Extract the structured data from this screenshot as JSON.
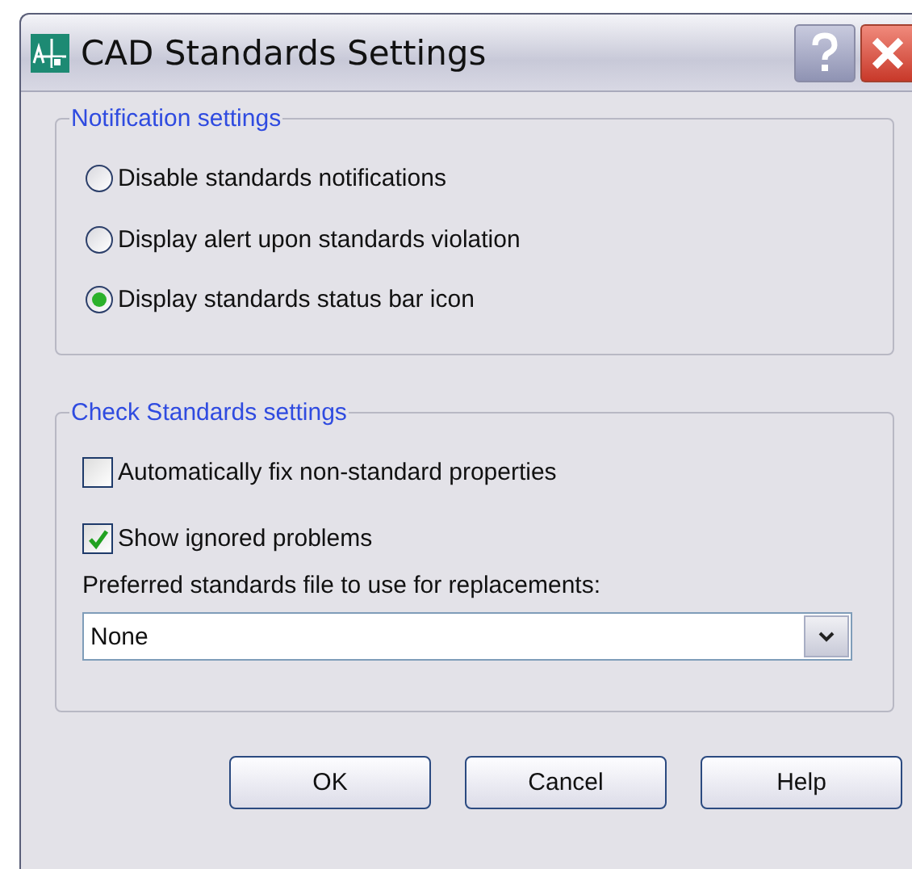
{
  "window": {
    "title": "CAD Standards Settings"
  },
  "notification_settings": {
    "title": "Notification settings",
    "options": [
      {
        "label": "Disable standards notifications",
        "selected": false
      },
      {
        "label": "Display alert upon standards violation",
        "selected": false
      },
      {
        "label": "Display standards status bar icon",
        "selected": true
      }
    ]
  },
  "check_standards_settings": {
    "title": "Check Standards settings",
    "checkboxes": [
      {
        "label": "Automatically fix non-standard properties",
        "checked": false
      },
      {
        "label": "Show ignored problems",
        "checked": true
      }
    ],
    "preferred_file_label": "Preferred standards file to use for replacements:",
    "preferred_file": {
      "value": "None"
    }
  },
  "buttons": [
    "OK",
    "Cancel",
    "Help"
  ]
}
